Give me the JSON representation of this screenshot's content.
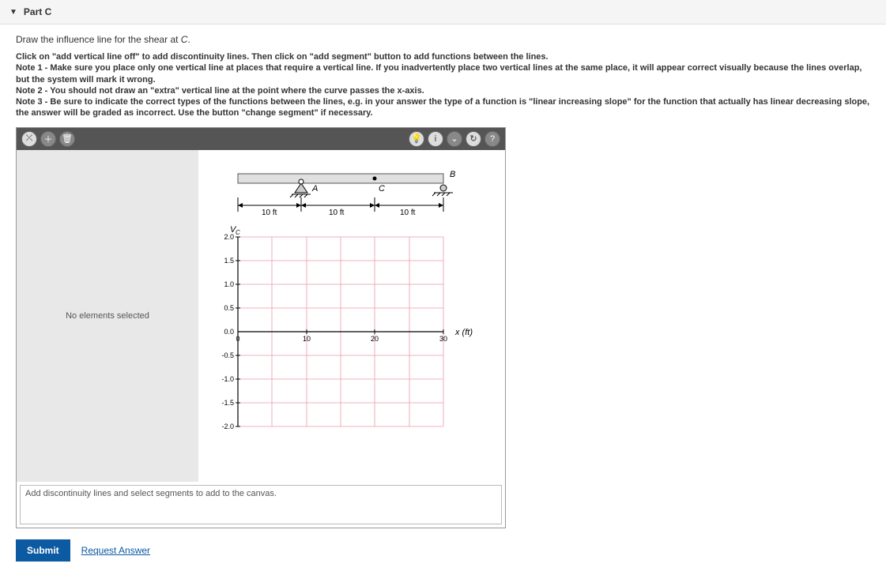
{
  "part": {
    "label": "Part C"
  },
  "prompt": "Draw the influence line for the shear at ",
  "prompt_var": "C",
  "notes": {
    "intro": "Click on \"add vertical line off\" to add discontinuity lines. Then click on \"add segment\" button to add functions between the lines.",
    "n1_label": "Note 1",
    "n1_text": " - Make sure you place only one vertical line at places that require a vertical line. If you inadvertently place two vertical lines at the same place, it will appear correct visually because the lines overlap, but the system will mark it wrong.",
    "n2_label": "Note 2",
    "n2_text": " - You should not draw an \"extra\" vertical line at the point where the curve passes the x-axis.",
    "n3_label": "Note 3",
    "n3_text": " - Be sure to indicate the correct types of the functions between the lines, e.g. in your answer the type of a function is \"linear increasing slope\" for the function that actually has linear decreasing slope, the answer will be graded as incorrect. Use the button \"change segment\" if necessary."
  },
  "sidepanel": {
    "selection_msg": "No elements selected"
  },
  "status": {
    "hint": "Add discontinuity lines and select segments to add to the canvas."
  },
  "actions": {
    "submit": "Submit",
    "request": "Request Answer"
  },
  "chart_data": {
    "type": "line",
    "title": "",
    "xlabel": "x (ft)",
    "ylabel": "V_C",
    "xlim": [
      0,
      30
    ],
    "ylim": [
      -2.0,
      2.0
    ],
    "xticks": [
      0,
      10,
      20,
      30
    ],
    "yticks": [
      2.0,
      1.5,
      1.0,
      0.5,
      0.0,
      -0.5,
      -1.0,
      -1.5,
      -2.0
    ],
    "series": [],
    "beam": {
      "spans": [
        "10 ft",
        "10 ft",
        "10 ft"
      ],
      "points": [
        {
          "label": "A",
          "x": 10,
          "support": "pin"
        },
        {
          "label": "C",
          "x": 20,
          "support": "none"
        },
        {
          "label": "B",
          "x": 30,
          "support": "roller"
        }
      ]
    }
  }
}
